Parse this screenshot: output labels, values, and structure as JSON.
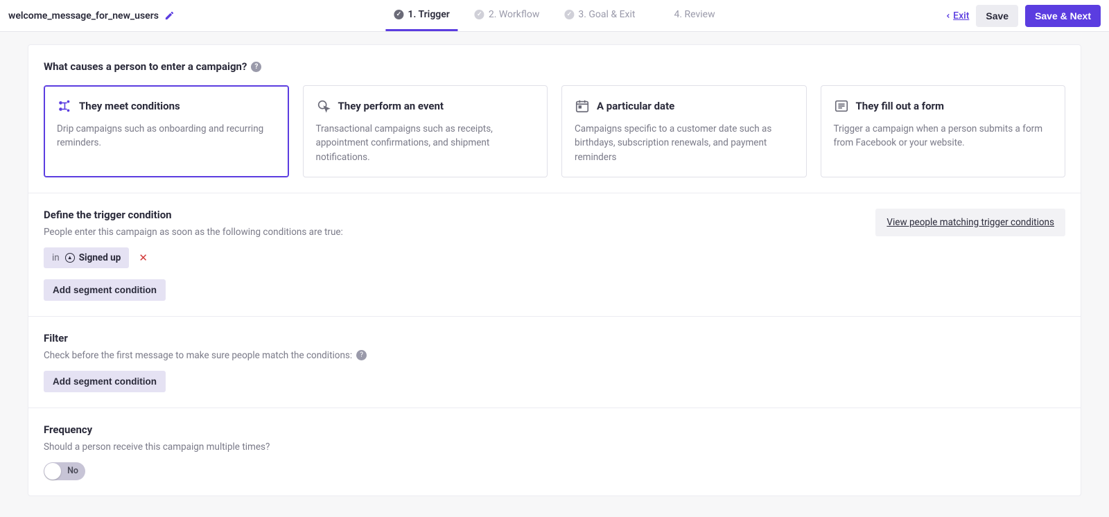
{
  "header": {
    "campaign_name": "welcome_message_for_new_users",
    "exit": "Exit",
    "save": "Save",
    "save_next": "Save & Next"
  },
  "steps": [
    {
      "label": "1. Trigger"
    },
    {
      "label": "2. Workflow"
    },
    {
      "label": "3. Goal & Exit"
    },
    {
      "label": "4. Review"
    }
  ],
  "question": "What causes a person to enter a campaign?",
  "triggers": [
    {
      "title": "They meet conditions",
      "desc": "Drip campaigns such as onboarding and recurring reminders."
    },
    {
      "title": "They perform an event",
      "desc": "Transactional campaigns such as receipts, appointment confirmations, and shipment notifications."
    },
    {
      "title": "A particular date",
      "desc": "Campaigns specific to a customer date such as birthdays, subscription renewals, and payment reminders"
    },
    {
      "title": "They fill out a form",
      "desc": "Trigger a campaign when a person submits a form from Facebook or your website."
    }
  ],
  "define": {
    "heading": "Define the trigger condition",
    "desc": "People enter this campaign as soon as the following conditions are true:",
    "chip_in": "in",
    "chip_segment": "Signed up",
    "add_btn": "Add segment condition",
    "view_link": "View people matching trigger conditions"
  },
  "filter": {
    "heading": "Filter",
    "desc": "Check before the first message to make sure people match the conditions:",
    "add_btn": "Add segment condition"
  },
  "frequency": {
    "heading": "Frequency",
    "desc": "Should a person receive this campaign multiple times?",
    "toggle_label": "No"
  }
}
